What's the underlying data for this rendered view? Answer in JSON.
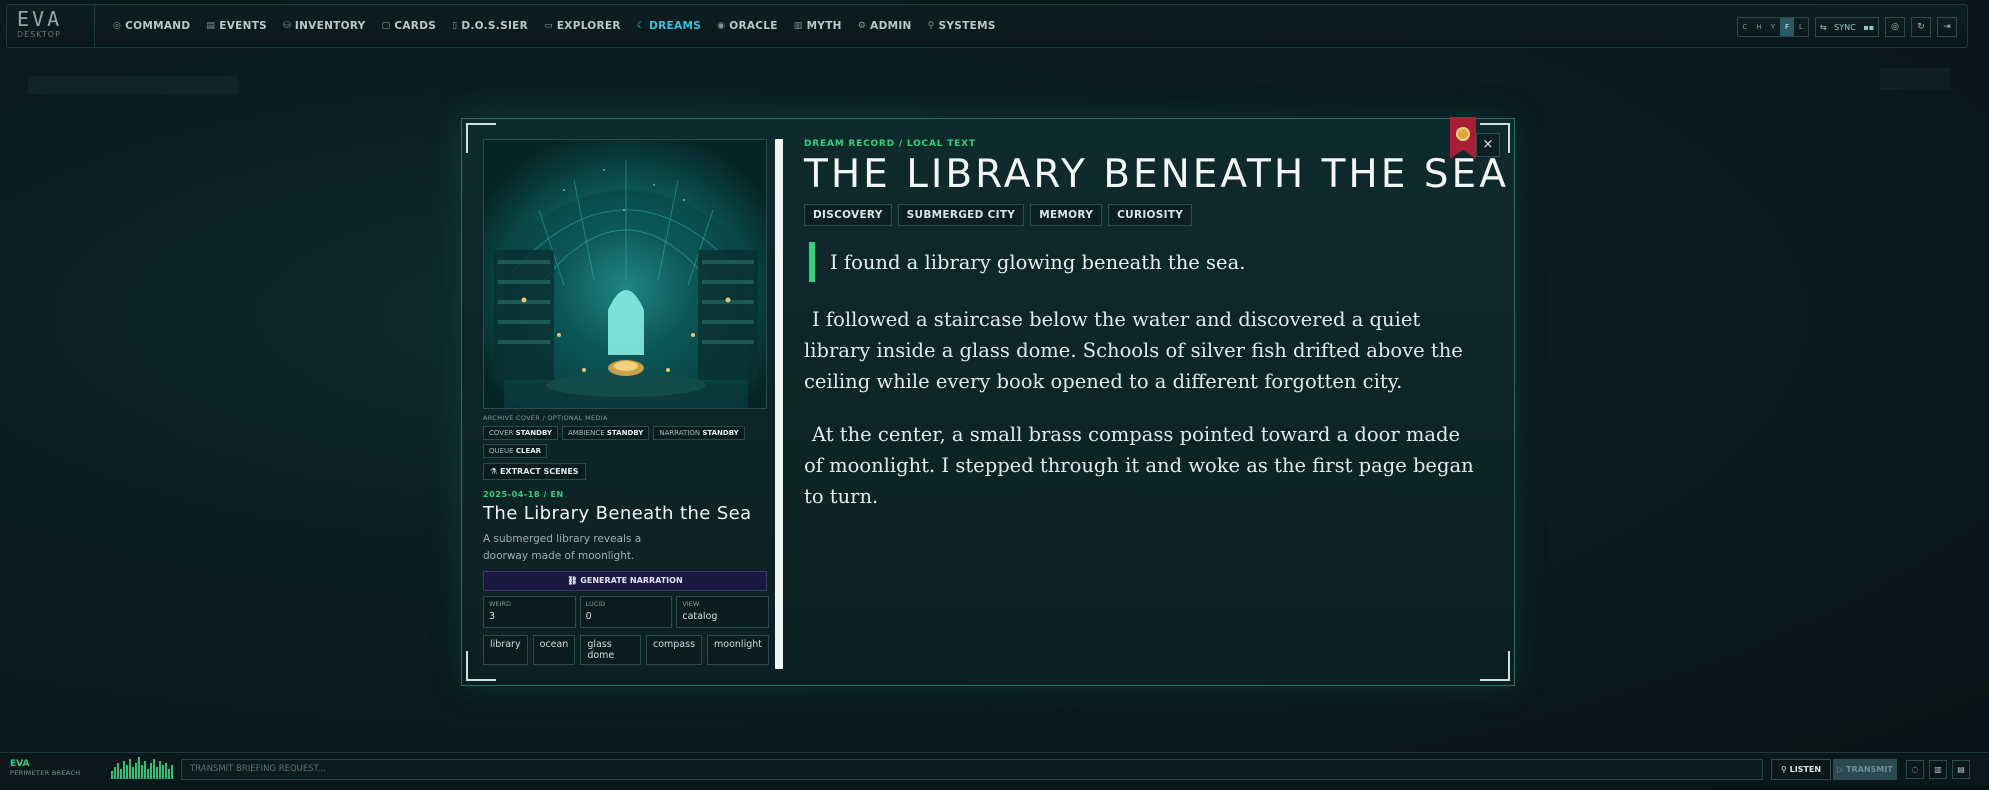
{
  "app": {
    "name": "EVA",
    "sub": "DESKTOP"
  },
  "nav": [
    {
      "label": "COMMAND",
      "icon": "command-icon",
      "glyph": "◎"
    },
    {
      "label": "EVENTS",
      "icon": "events-icon",
      "glyph": "▤"
    },
    {
      "label": "INVENTORY",
      "icon": "inventory-icon",
      "glyph": "⛁"
    },
    {
      "label": "CARDS",
      "icon": "cards-icon",
      "glyph": "▢"
    },
    {
      "label": "D.O.S.SIER",
      "icon": "dossier-icon",
      "glyph": "▯"
    },
    {
      "label": "EXPLORER",
      "icon": "explorer-icon",
      "glyph": "▭"
    },
    {
      "label": "DREAMS",
      "icon": "dreams-icon",
      "glyph": "☾",
      "active": true
    },
    {
      "label": "ORACLE",
      "icon": "oracle-icon",
      "glyph": "◉"
    },
    {
      "label": "MYTH",
      "icon": "myth-icon",
      "glyph": "▥"
    },
    {
      "label": "ADMIN",
      "icon": "admin-icon",
      "glyph": "⚙"
    },
    {
      "label": "SYSTEMS",
      "icon": "systems-icon",
      "glyph": "⚲"
    }
  ],
  "toolbar": {
    "seg": [
      "C",
      "H",
      "Y",
      "F",
      "L"
    ],
    "sync_label": "SYNC"
  },
  "dream": {
    "kicker": "DREAM RECORD / LOCAL TEXT",
    "title_caps": "THE LIBRARY BENEATH THE SEA",
    "themes": [
      "DISCOVERY",
      "SUBMERGED CITY",
      "MEMORY",
      "CURIOSITY"
    ],
    "lead": "I found a library glowing beneath the sea.",
    "paragraphs": [
      "I followed a staircase below the water and discovered a quiet library inside a glass dome. Schools of silver fish drifted above the ceiling while every book opened to a different forgotten city.",
      "At the center, a small brass compass pointed toward a door made of moonlight. I stepped through it and woke as the first page began to turn."
    ],
    "cover_caption": "ARCHIVE COVER / OPTIONAL MEDIA",
    "media_status": [
      {
        "label": "COVER",
        "value": "STANDBY"
      },
      {
        "label": "AMBIENCE",
        "value": "STANDBY"
      },
      {
        "label": "NARRATION",
        "value": "STANDBY"
      },
      {
        "label": "QUEUE",
        "value": "CLEAR"
      }
    ],
    "extract_label": "EXTRACT SCENES",
    "date_lang": "2025-04-18 / EN",
    "title": "The Library Beneath the Sea",
    "summary": "A submerged library reveals a doorway made of moonlight.",
    "generate_label": "GENERATE NARRATION",
    "stats": [
      {
        "key": "WEIRD",
        "value": "3"
      },
      {
        "key": "LUCID",
        "value": "0"
      },
      {
        "key": "VIEW",
        "value": "catalog"
      }
    ],
    "tags": [
      "library",
      "ocean",
      "glass dome",
      "compass",
      "moonlight"
    ],
    "close_label": "×"
  },
  "bottom": {
    "name": "EVA",
    "status": "PERIMETER BREACH",
    "input_placeholder": "TRANSMIT BRIEFING REQUEST...",
    "listen_label": "LISTEN",
    "transmit_label": "TRANSMIT"
  },
  "colors": {
    "accent_green": "#2fd47e",
    "accent_cyan": "#36c3e0",
    "bookmark_red": "#a81f36"
  }
}
